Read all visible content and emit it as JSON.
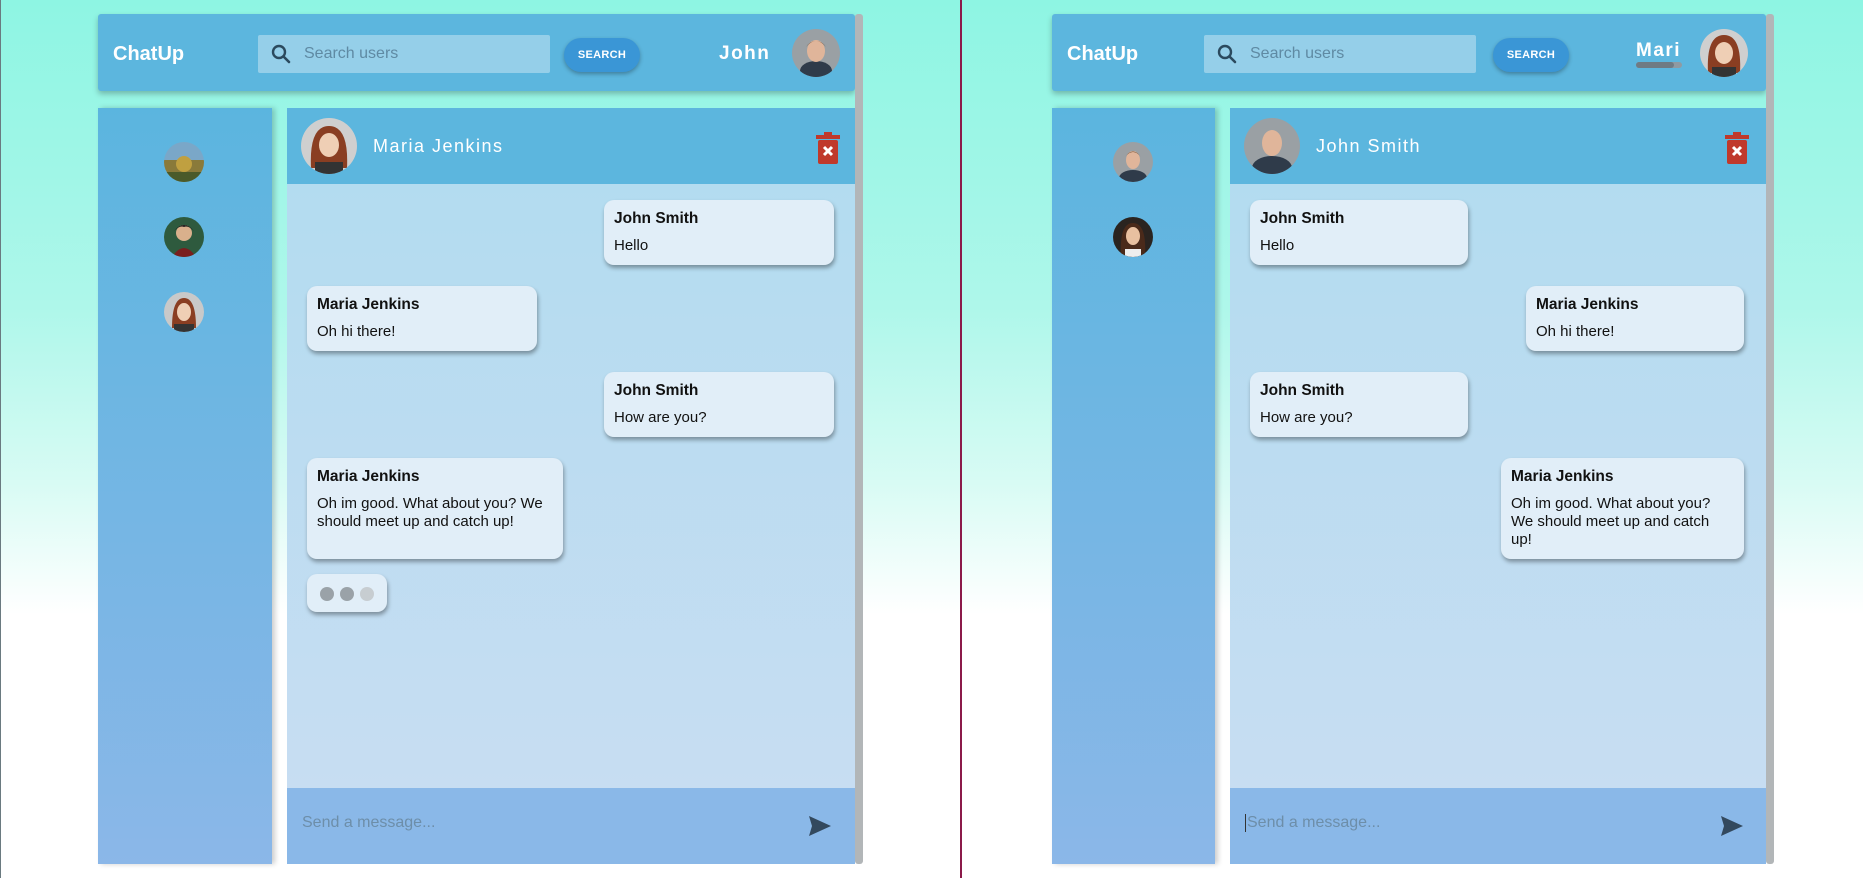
{
  "left": {
    "header": {
      "brand": "ChatUp",
      "search_placeholder": "Search users",
      "search_button": "SEARCH",
      "username": "John"
    },
    "chat": {
      "contact_name": "Maria Jenkins",
      "composer_placeholder": "Send a message...",
      "messages": [
        {
          "sender": "John Smith",
          "text": "Hello",
          "side": "right"
        },
        {
          "sender": "Maria Jenkins",
          "text": "Oh hi there!",
          "side": "left"
        },
        {
          "sender": "John Smith",
          "text": "How are you?",
          "side": "right"
        },
        {
          "sender": "Maria Jenkins",
          "text": "Oh im good. What about you? We should meet up and catch up!",
          "side": "left"
        }
      ],
      "typing_indicator": true
    }
  },
  "right": {
    "header": {
      "brand": "ChatUp",
      "search_placeholder": "Search users",
      "search_button": "SEARCH",
      "username": "Mari"
    },
    "chat": {
      "contact_name": "John Smith",
      "composer_placeholder": "Send a message...",
      "messages": [
        {
          "sender": "John Smith",
          "text": "Hello",
          "side": "left"
        },
        {
          "sender": "Maria Jenkins",
          "text": "Oh hi there!",
          "side": "right"
        },
        {
          "sender": "John Smith",
          "text": "How are you?",
          "side": "left"
        },
        {
          "sender": "Maria Jenkins",
          "text": "Oh im good. What about you? We should meet up and catch up!",
          "side": "right"
        }
      ]
    }
  },
  "colors": {
    "header": "#5cb6de",
    "search_button": "#3a96d6",
    "delete_icon": "#c0392b",
    "bubble": "#e1eef8"
  }
}
